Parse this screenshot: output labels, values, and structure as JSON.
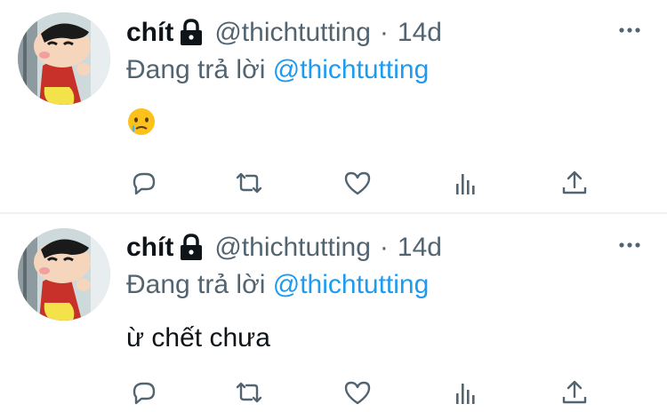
{
  "tweets": [
    {
      "name": "chít",
      "handle": "@thichtutting",
      "separator": "·",
      "time": "14d",
      "reply_prefix": "Đang trả lời ",
      "reply_to": "@thichtutting",
      "content": "",
      "content_emoji": "crying-face-emoji",
      "actions": [
        "reply-icon",
        "retweet-icon",
        "like-icon",
        "analytics-icon",
        "share-icon"
      ]
    },
    {
      "name": "chít",
      "handle": "@thichtutting",
      "separator": "·",
      "time": "14d",
      "reply_prefix": "Đang trả lời ",
      "reply_to": "@thichtutting",
      "content": "ừ chết chưa",
      "actions": [
        "reply-icon",
        "retweet-icon",
        "like-icon",
        "analytics-icon",
        "share-icon"
      ]
    }
  ],
  "colors": {
    "text": "#0f1419",
    "secondary": "#536471",
    "link": "#1d9bf0",
    "divider": "#eff3f4"
  }
}
